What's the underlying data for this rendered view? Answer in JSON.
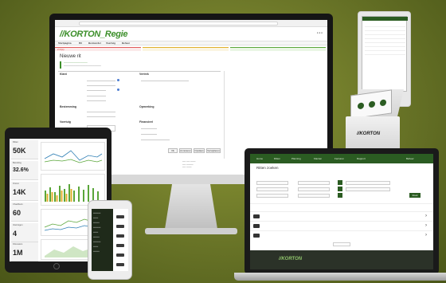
{
  "imac": {
    "brand": "//KORTON_Regie",
    "title": "Nieuwe rit",
    "nav_items": [
      "Startpagina",
      "Rit",
      "Bestuurder",
      "Voertuig",
      "Beheer"
    ],
    "status_items": [
      "2 rit(s)",
      "",
      ""
    ],
    "section_left": "Klant",
    "section_right": "Vertrek",
    "section_left2": "Bestemming",
    "section_right2": "Opmerking",
    "section_left3": "Voertuig",
    "section_right3": "Financieel",
    "amount": "100,00 / 200",
    "buttons": [
      "Ok",
      "Annuleren",
      "Opslaan",
      "Verwijderen"
    ]
  },
  "tablet": {
    "tiles": [
      {
        "label": "Ritten",
        "value": "50K"
      },
      {
        "label": "Bezetting",
        "value": "32.6%"
      },
      {
        "label": "Omzet",
        "value": "14K"
      },
      {
        "label": "Chauffeurs",
        "value": "60"
      },
      {
        "label": "Voertuigen",
        "value": "4"
      },
      {
        "label": "Kilometers",
        "value": "1M"
      }
    ]
  },
  "laptop": {
    "brand": "//KORTON",
    "title": "Ritten zoeken",
    "nav_items": [
      "Home",
      "Ritten",
      "Planning",
      "Klanten",
      "Facturen",
      "Rapport",
      "Beheer"
    ],
    "search_label": "Zoek",
    "rows": 4
  },
  "kiosk": {
    "brand": "//KORTON"
  },
  "colors": {
    "accent": "#3c8f2a",
    "nav_dark": "#2b5c22",
    "background": "#6f7a2a"
  }
}
